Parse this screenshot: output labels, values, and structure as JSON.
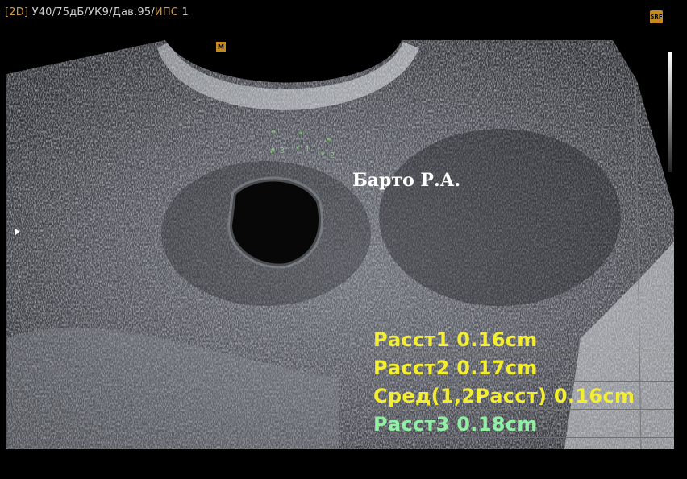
{
  "header": {
    "mode": "[2D]",
    "params": "У40/75дБ/УК9/Дав.95/",
    "ips_label": "ИПС",
    "ips_value": "1"
  },
  "srf_badge": "SRF",
  "focus_marker": "M",
  "patient_name": "Барто Р.А.",
  "calipers": [
    "# 3",
    "* 1",
    "* 2"
  ],
  "measurements": [
    {
      "text": "Расст1 0.16cm",
      "color": "#f3ee2e"
    },
    {
      "text": "Расст2 0.17cm",
      "color": "#f3ee2e"
    },
    {
      "text": "Сред(1,2Расст) 0.16cm",
      "color": "#f3ee2e"
    },
    {
      "text": "Расст3 0.18cm",
      "color": "#8ff0a4"
    }
  ]
}
